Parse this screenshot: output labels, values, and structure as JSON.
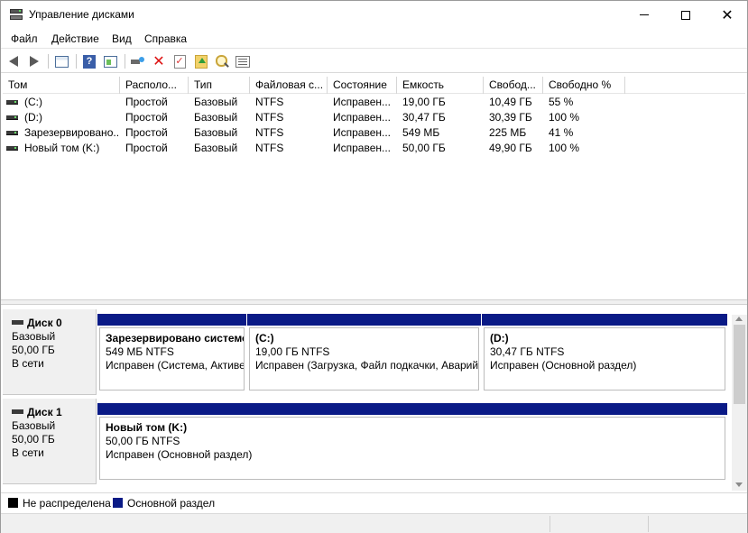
{
  "window": {
    "title": "Управление дисками"
  },
  "menu": [
    "Файл",
    "Действие",
    "Вид",
    "Справка"
  ],
  "toolbar": {
    "icons": [
      "back-arrow-icon",
      "forward-arrow-icon",
      "console-tree-icon",
      "help-icon",
      "action-pane-icon",
      "connect-disk-icon",
      "delete-icon",
      "check-icon",
      "folder-up-icon",
      "search-icon",
      "properties-icon"
    ]
  },
  "columns": [
    "Том",
    "Располо...",
    "Тип",
    "Файловая с...",
    "Состояние",
    "Емкость",
    "Свобод...",
    "Свободно %"
  ],
  "volumes": [
    [
      "(C:)",
      "Простой",
      "Базовый",
      "NTFS",
      "Исправен...",
      "19,00 ГБ",
      "10,49 ГБ",
      "55 %"
    ],
    [
      "(D:)",
      "Простой",
      "Базовый",
      "NTFS",
      "Исправен...",
      "30,47 ГБ",
      "30,39 ГБ",
      "100 %"
    ],
    [
      "Зарезервировано...",
      "Простой",
      "Базовый",
      "NTFS",
      "Исправен...",
      "549 МБ",
      "225 МБ",
      "41 %"
    ],
    [
      "Новый том (K:)",
      "Простой",
      "Базовый",
      "NTFS",
      "Исправен...",
      "50,00 ГБ",
      "49,90 ГБ",
      "100 %"
    ]
  ],
  "disks": [
    {
      "name": "Диск 0",
      "type": "Базовый",
      "size": "50,00 ГБ",
      "status": "В сети",
      "partitions": [
        {
          "name": "Зарезервировано системой",
          "size": "549 МБ NTFS",
          "status": "Исправен (Система, Активен, Основной раздел)"
        },
        {
          "name": "(C:)",
          "size": "19,00 ГБ NTFS",
          "status": "Исправен (Загрузка, Файл подкачки, Аварийный дамп памяти, Основной раздел)"
        },
        {
          "name": "(D:)",
          "size": "30,47 ГБ NTFS",
          "status": "Исправен (Основной раздел)"
        }
      ]
    },
    {
      "name": "Диск 1",
      "type": "Базовый",
      "size": "50,00 ГБ",
      "status": "В сети",
      "partitions": [
        {
          "name": "Новый том  (K:)",
          "size": "50,00 ГБ NTFS",
          "status": "Исправен (Основной раздел)"
        }
      ]
    }
  ],
  "legend": [
    {
      "label": "Не распределена",
      "color": "#000000"
    },
    {
      "label": "Основной раздел",
      "color": "#0a1a86"
    }
  ]
}
